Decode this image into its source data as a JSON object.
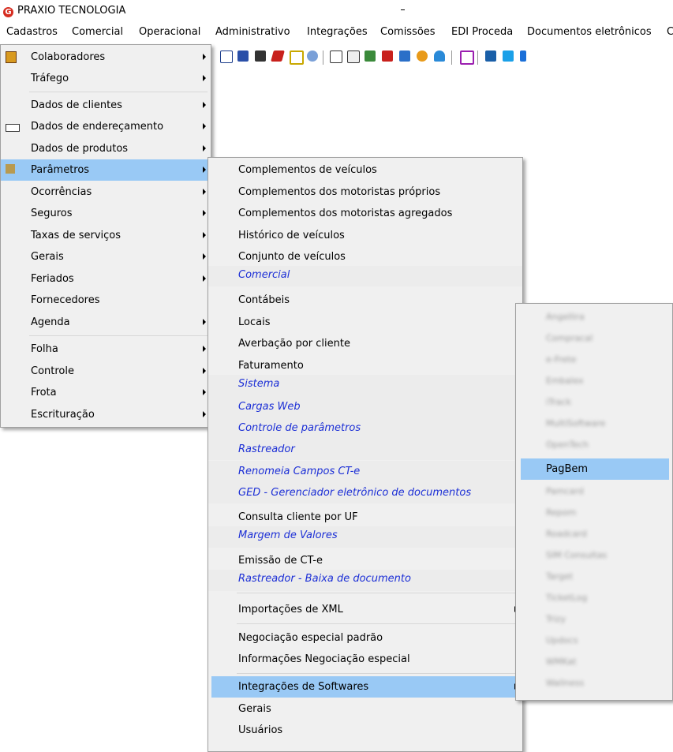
{
  "app": {
    "title": "PRAXIO TECNOLOGIA",
    "logo_letter": "G",
    "accent": "#d62d20"
  },
  "menubar": {
    "items": [
      "Cadastros",
      "Comercial",
      "Operacional",
      "Administrativo",
      "Integrações",
      "Comissões",
      "EDI Proceda",
      "Documentos eletrônicos",
      "C"
    ]
  },
  "cadastros_menu": {
    "items": [
      {
        "label": "Colaboradores",
        "icon": "colaboradores-icon",
        "submenu": true
      },
      {
        "label": "Tráfego",
        "submenu": true
      },
      {
        "label": "Dados de clientes",
        "submenu": true
      },
      {
        "label": "Dados de endereçamento",
        "icon": "address-card-icon",
        "submenu": true
      },
      {
        "label": "Dados de produtos",
        "submenu": true
      },
      {
        "label": "Parâmetros",
        "icon": "tools-icon",
        "submenu": true,
        "selected": true
      },
      {
        "label": "Ocorrências",
        "submenu": true
      },
      {
        "label": "Seguros",
        "submenu": true
      },
      {
        "label": "Taxas de serviços",
        "submenu": true
      },
      {
        "label": "Gerais",
        "submenu": true
      },
      {
        "label": "Feriados",
        "submenu": true
      },
      {
        "label": "Fornecedores",
        "submenu": false
      },
      {
        "label": "Agenda",
        "submenu": true
      },
      {
        "label": "Folha",
        "submenu": true
      },
      {
        "label": "Controle",
        "submenu": true
      },
      {
        "label": "Frota",
        "submenu": true
      },
      {
        "label": "Escrituração",
        "submenu": true
      }
    ]
  },
  "parametros_menu": {
    "items": [
      {
        "label": "Complementos de veículos"
      },
      {
        "label": "Complementos dos motoristas próprios"
      },
      {
        "label": "Complementos dos motoristas agregados"
      },
      {
        "label": "Histórico de veículos"
      },
      {
        "label": "Conjunto de veículos"
      },
      {
        "label": "Comercial",
        "group": true
      },
      {
        "label": "Contábeis"
      },
      {
        "label": "Locais"
      },
      {
        "label": "Averbação por cliente"
      },
      {
        "label": "Faturamento"
      },
      {
        "label": "Sistema",
        "group": true
      },
      {
        "label": "Cargas Web",
        "group": true
      },
      {
        "label": "Controle de parâmetros",
        "group": true
      },
      {
        "label": "Rastreador",
        "group": true
      },
      {
        "label": "Renomeia Campos CT-e",
        "group": true
      },
      {
        "label": "GED - Gerenciador eletrônico de documentos",
        "group": true
      },
      {
        "label": "Consulta cliente por UF"
      },
      {
        "label": "Margem de Valores",
        "group": true
      },
      {
        "label": "Emissão de CT-e"
      },
      {
        "label": "Rastreador - Baixa de documento",
        "group": true
      },
      {
        "label": "Importações de XML",
        "submenu": true
      },
      {
        "label": "Negociação especial padrão"
      },
      {
        "label": "Informações Negociação especial"
      },
      {
        "label": "Integrações de Softwares",
        "submenu": true,
        "selected": true
      },
      {
        "label": "Gerais"
      },
      {
        "label": "Usuários"
      }
    ]
  },
  "integracoes_menu": {
    "items": [
      {
        "label": "Angellira",
        "blurred": true
      },
      {
        "label": "Compracal",
        "blurred": true
      },
      {
        "label": "e-Frete",
        "blurred": true
      },
      {
        "label": "Embalex",
        "blurred": true
      },
      {
        "label": "iTrack",
        "blurred": true
      },
      {
        "label": "MultiSoftware",
        "blurred": true
      },
      {
        "label": "OpenTech",
        "blurred": true
      },
      {
        "label": "PagBem",
        "selected": true
      },
      {
        "label": "Pamcard",
        "blurred": true
      },
      {
        "label": "Repom",
        "blurred": true
      },
      {
        "label": "Roadcard",
        "blurred": true
      },
      {
        "label": "SIM Consultas",
        "blurred": true
      },
      {
        "label": "Target",
        "blurred": true
      },
      {
        "label": "TicketLog",
        "blurred": true
      },
      {
        "label": "Trizy",
        "blurred": true
      },
      {
        "label": "Updocs",
        "blurred": true
      },
      {
        "label": "WMKat",
        "blurred": true
      },
      {
        "label": "Wallness",
        "blurred": true
      }
    ]
  },
  "colors": {
    "selection": "#99c9f5",
    "group_text": "#1c2fd6",
    "menu_bg": "#f0f0f0"
  }
}
